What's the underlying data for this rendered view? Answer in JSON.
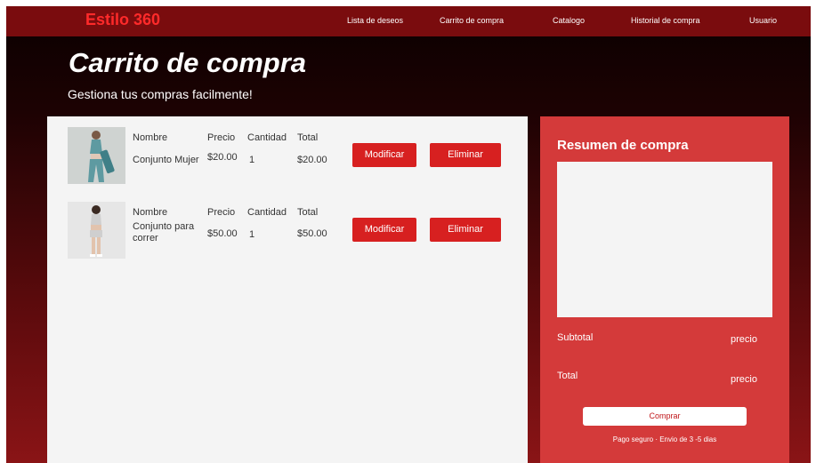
{
  "navbar": {
    "brand": "Estilo 360",
    "links": [
      "Lista de deseos",
      "Carrito de compra",
      "Catalogo",
      "Historial de compra",
      "Usuario"
    ]
  },
  "hero": {
    "title": "Carrito de compra",
    "subtitle": "Gestiona tus compras facilmente!"
  },
  "cart": {
    "columns": {
      "name": "Nombre",
      "price": "Precio",
      "qty": "Cantidad",
      "total": "Total"
    },
    "items": [
      {
        "name": "Conjunto Mujer",
        "price": "$20.00",
        "qty": "1",
        "total": "$20.00",
        "modify_label": "Modificar",
        "delete_label": "Eliminar",
        "image_icon": "woman-athletic-outfit-image"
      },
      {
        "name": "Conjunto para correr",
        "price": "$50.00",
        "qty": "1",
        "total": "$50.00",
        "modify_label": "Modificar",
        "delete_label": "Eliminar",
        "image_icon": "woman-running-outfit-image"
      }
    ]
  },
  "summary": {
    "title": "Resumen de compra",
    "subtotal_label": "Subtotal",
    "subtotal_value": "precio",
    "total_label": "Total",
    "total_value": "precio",
    "buy_label": "Comprar",
    "secure_note": "Pago seguro · Envio de 3 -5 dias"
  },
  "colors": {
    "brand": "#ff2a2a",
    "navbar": "#7a0c0e",
    "button": "#d72020",
    "summary_bg": "#d43a3a"
  }
}
